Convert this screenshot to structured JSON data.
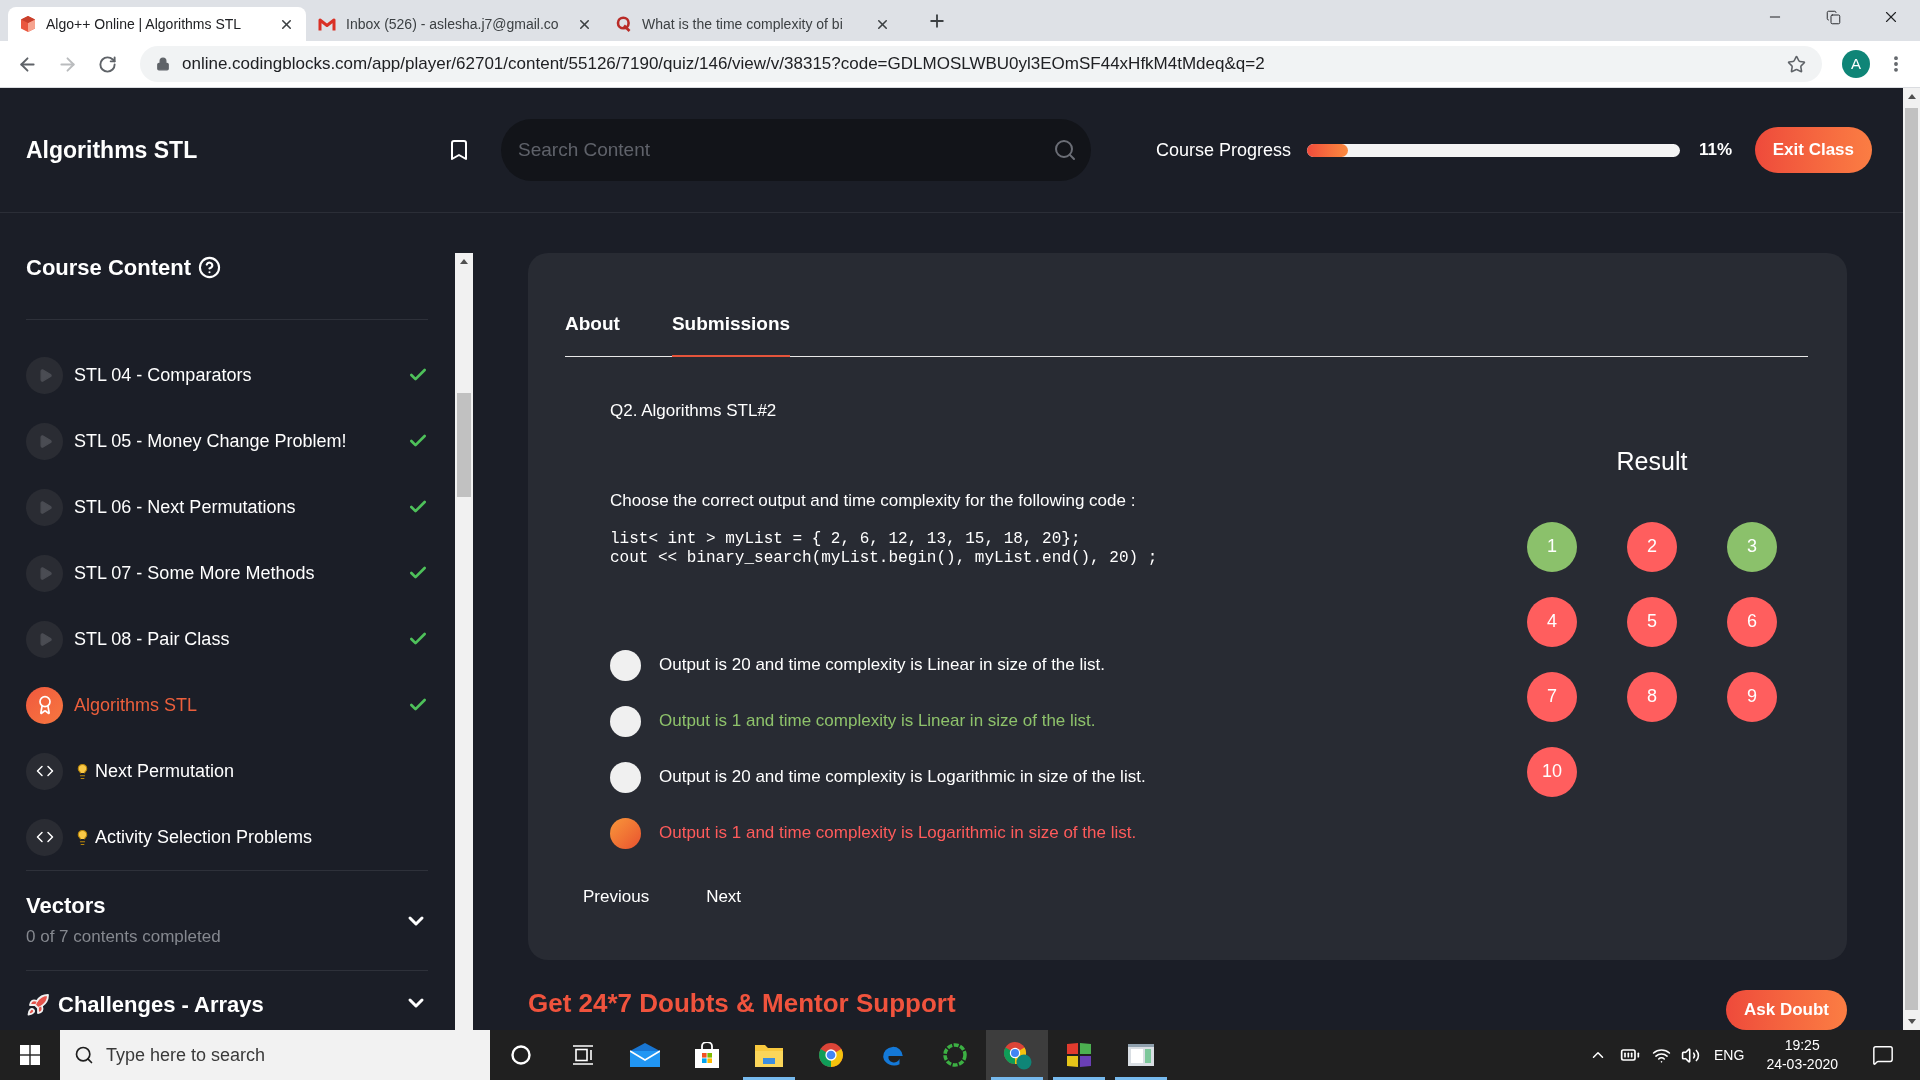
{
  "browser": {
    "tabs": [
      {
        "title": "Algo++ Online | Algorithms STL",
        "selected": true
      },
      {
        "title": "Inbox (526) - aslesha.j7@gmail.co",
        "selected": false
      },
      {
        "title": "What is the time complexity of bi",
        "selected": false
      }
    ],
    "url": "online.codingblocks.com/app/player/62701/content/55126/7190/quiz/146/view/v/38315?code=GDLMOSLWBU0yl3EOmSF44xHfkM4tMdeq&q=2",
    "profile_initial": "A"
  },
  "header": {
    "title": "Algorithms STL",
    "search": {
      "placeholder": "Search Content"
    },
    "progress": {
      "label": "Course Progress",
      "level": 0.11,
      "reading": "11%"
    },
    "exit_button": "Exit Class"
  },
  "sidebar": {
    "title": "Course Content",
    "items": [
      {
        "kind": "video",
        "title": "STL 04 - Comparators",
        "done": true,
        "selected": false
      },
      {
        "kind": "video",
        "title": "STL 05 - Money Change Problem!",
        "done": true,
        "selected": false
      },
      {
        "kind": "video",
        "title": "STL 06 - Next Permutations",
        "done": true,
        "selected": false
      },
      {
        "kind": "video",
        "title": "STL 07 - Some More Methods",
        "done": true,
        "selected": false
      },
      {
        "kind": "video",
        "title": "STL 08 - Pair Class",
        "done": true,
        "selected": false
      },
      {
        "kind": "quiz",
        "title": "Algorithms STL",
        "done": true,
        "selected": true
      },
      {
        "kind": "code",
        "title": "Next Permutation",
        "done": false,
        "selected": false
      },
      {
        "kind": "code",
        "title": "Activity Selection Problems",
        "done": false,
        "selected": false
      }
    ],
    "sections": [
      {
        "kind": "topic",
        "title": "Vectors",
        "subtitle": "0 of 7 contents completed",
        "expanded": false
      },
      {
        "kind": "challenge",
        "title": "Challenges - Arrays",
        "expanded": false
      }
    ]
  },
  "quiz": {
    "tabs": [
      {
        "label": "About",
        "selected": false
      },
      {
        "label": "Submissions",
        "selected": true
      }
    ],
    "question_title": "Q2. Algorithms STL#2",
    "prompt": "Choose the correct output and time complexity for the following code :",
    "code": [
      "list< int > myList = { 2, 6, 12, 13, 15, 18, 20};",
      "cout << binary_search(myList.begin(), myList.end(), 20) ;"
    ],
    "options": [
      {
        "text": "Output is 20 and time complexity is Linear in size of the list.",
        "selected": false,
        "correct": false
      },
      {
        "text": "Output is 1 and time complexity is Linear in size of the list.",
        "selected": false,
        "correct": true
      },
      {
        "text": "Output is 20 and time complexity is Logarithmic in size of the list.",
        "selected": false,
        "correct": false
      },
      {
        "text": "Output is 1 and time complexity is Logarithmic in size of the list.",
        "selected": true,
        "correct": false
      }
    ],
    "result_title": "Result",
    "results": [
      {
        "label": "1",
        "color": "#8bc16b"
      },
      {
        "label": "2",
        "color": "#ff5e5e"
      },
      {
        "label": "3",
        "color": "#8bc16b"
      },
      {
        "label": "4",
        "color": "#ff5e5e"
      },
      {
        "label": "5",
        "color": "#ff5e5e"
      },
      {
        "label": "6",
        "color": "#ff5e5e"
      },
      {
        "label": "7",
        "color": "#ff5e5e"
      },
      {
        "label": "8",
        "color": "#ff5e5e"
      },
      {
        "label": "9",
        "color": "#ff5e5e"
      },
      {
        "label": "10",
        "color": "#ff5e5e"
      }
    ],
    "previous": "Previous",
    "next": "Next"
  },
  "banner": {
    "title": "Get 24*7 Doubts & Mentor Support",
    "button": "Ask Doubt"
  },
  "taskbar": {
    "search_placeholder": "Type here to search",
    "buttons": [
      {
        "running": false,
        "active": false
      },
      {
        "running": false,
        "active": false
      },
      {
        "running": false,
        "active": false
      },
      {
        "running": false,
        "active": false
      },
      {
        "running": true,
        "active": false
      },
      {
        "running": false,
        "active": false
      },
      {
        "running": false,
        "active": false
      },
      {
        "running": false,
        "active": false
      },
      {
        "running": true,
        "active": true
      },
      {
        "running": true,
        "active": false
      },
      {
        "running": true,
        "active": false
      }
    ],
    "language": "ENG",
    "time": "19:25",
    "date": "24-03-2020"
  }
}
